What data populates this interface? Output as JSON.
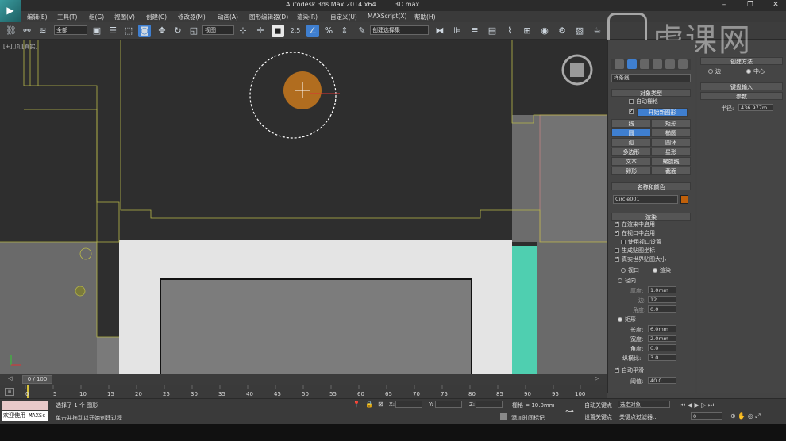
{
  "title_bar": {
    "app_title": "Autodesk 3ds Max  2014 x64",
    "file_name": "3D.max"
  },
  "menu": [
    "编辑(E)",
    "工具(T)",
    "组(G)",
    "视图(V)",
    "创建(C)",
    "修改器(M)",
    "动画(A)",
    "图形编辑器(D)",
    "渲染(R)",
    "自定义(U)",
    "MAXScript(X)",
    "帮助(H)"
  ],
  "toolbar": {
    "filter_value": "全部",
    "ref_coord_value": "视图",
    "named_selection": "创建选择集",
    "snap_label": "2.5"
  },
  "viewport": {
    "label": "[+][顶][真实]"
  },
  "watermark": {
    "text": "虎课网"
  },
  "create_panel": {
    "category_value": "样条线",
    "object_type_header": "对象类型",
    "auto_grid": "自动栅格",
    "start_new_shape": "开始新图形",
    "buttons": [
      "线",
      "矩形",
      "圆",
      "椭圆",
      "弧",
      "圆环",
      "多边形",
      "星形",
      "文本",
      "螺旋线",
      "卵形",
      "截面"
    ],
    "name_color_header": "名称和颜色",
    "object_name": "Circle001",
    "object_color": "#c0600a",
    "rendering_header": "渲染",
    "enable_in_renderer": "在渲染中启用",
    "enable_in_viewport": "在视口中启用",
    "use_viewport_settings": "使用视口设置",
    "generate_mapping": "生成贴图坐标",
    "real_world_map": "真实世界贴图大小",
    "viewport_radio": "视口",
    "render_radio": "渲染",
    "radial": "径向",
    "thickness_label": "厚度:",
    "thickness_value": "1.0mm",
    "sides_label": "边:",
    "sides_value": "12",
    "angle_label": "角度:",
    "angle_value": "0.0",
    "rectangular": "矩形",
    "length_label": "长度:",
    "length_value": "6.0mm",
    "width_label": "宽度:",
    "width_value": "2.0mm",
    "rect_angle_label": "角度:",
    "rect_angle_value": "0.0",
    "aspect_label": "纵横比:",
    "aspect_value": "3.0",
    "auto_smooth": "自动平滑",
    "threshold_label": "阈值:",
    "threshold_value": "40.0"
  },
  "creation_method": {
    "header": "创建方法",
    "edge": "边",
    "center": "中心",
    "keyboard_header": "键盘输入",
    "params_header": "参数",
    "radius_label": "半径:",
    "radius_value": "436.977m"
  },
  "timeline": {
    "frame": "0 / 100",
    "ticks": [
      "0",
      "5",
      "10",
      "15",
      "20",
      "25",
      "30",
      "35",
      "40",
      "45",
      "50",
      "55",
      "60",
      "65",
      "70",
      "75",
      "80",
      "85",
      "90",
      "95",
      "100"
    ]
  },
  "status": {
    "script_label": "欢迎使用 MAXSc",
    "selected": "选择了 1 个 图形",
    "prompt": "单击并拖动以开始创建过程",
    "x_label": "X:",
    "y_label": "Y:",
    "z_label": "Z:",
    "grid": "栅格 = 10.0mm",
    "add_time_tag": "添加时间标记",
    "auto_key": "自动关键点",
    "selected_obj": "选定对象",
    "set_key": "设置关键点",
    "key_filters": "关键点过滤器...",
    "frame_value": "0"
  },
  "colors": {
    "accent_blue": "#3f7fd0",
    "teal_wall": "#4fcfb0",
    "circle_fill": "#c0741e"
  }
}
